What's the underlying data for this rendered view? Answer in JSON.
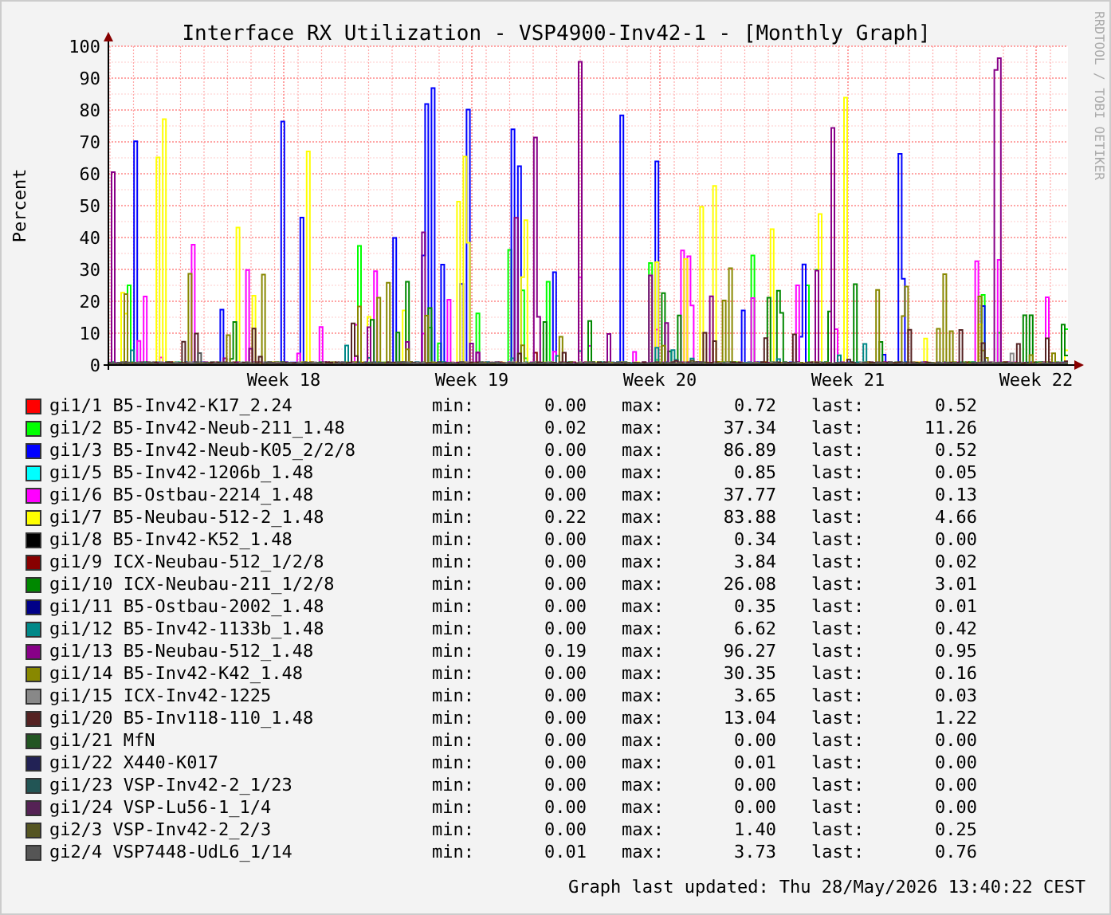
{
  "graph": {
    "title": "Interface RX Utilization - VSP4900-Inv42-1 - [Monthly Graph]",
    "ylabel": "Percent",
    "side_text": "RRDTOOL / TOBI OETIKER",
    "yticks": [
      "100",
      "90",
      "80",
      "70",
      "60",
      "50",
      "40",
      "30",
      "20",
      "10",
      "0"
    ],
    "xticks": [
      "Week 18",
      "Week 19",
      "Week 20",
      "Week 21",
      "Week 22"
    ]
  },
  "legend": [
    {
      "color": "#ff0000",
      "label": "gi1/1 B5-Inv42-K17_2.24",
      "min_label": "min:",
      "min": "0.00",
      "max_label": "max:",
      "max": "0.72",
      "last_label": "last:",
      "last": "0.52"
    },
    {
      "color": "#00ff00",
      "label": "gi1/2 B5-Inv42-Neub-211_1.48",
      "min_label": "min:",
      "min": "0.02",
      "max_label": "max:",
      "max": "37.34",
      "last_label": "last:",
      "last": "11.26"
    },
    {
      "color": "#0000ff",
      "label": "gi1/3 B5-Inv42-Neub-K05_2/2/8",
      "min_label": "min:",
      "min": "0.00",
      "max_label": "max:",
      "max": "86.89",
      "last_label": "last:",
      "last": "0.52"
    },
    {
      "color": "#00ffff",
      "label": "gi1/5 B5-Inv42-1206b_1.48",
      "min_label": "min:",
      "min": "0.00",
      "max_label": "max:",
      "max": "0.85",
      "last_label": "last:",
      "last": "0.05"
    },
    {
      "color": "#ff00ff",
      "label": "gi1/6 B5-Ostbau-2214_1.48",
      "min_label": "min:",
      "min": "0.00",
      "max_label": "max:",
      "max": "37.77",
      "last_label": "last:",
      "last": "0.13"
    },
    {
      "color": "#ffff00",
      "label": "gi1/7 B5-Neubau-512-2_1.48",
      "min_label": "min:",
      "min": "0.22",
      "max_label": "max:",
      "max": "83.88",
      "last_label": "last:",
      "last": "4.66"
    },
    {
      "color": "#000000",
      "label": "gi1/8 B5-Inv42-K52_1.48",
      "min_label": "min:",
      "min": "0.00",
      "max_label": "max:",
      "max": "0.34",
      "last_label": "last:",
      "last": "0.00"
    },
    {
      "color": "#880000",
      "label": "gi1/9 ICX-Neubau-512_1/2/8",
      "min_label": "min:",
      "min": "0.00",
      "max_label": "max:",
      "max": "3.84",
      "last_label": "last:",
      "last": "0.02"
    },
    {
      "color": "#008800",
      "label": "gi1/10 ICX-Neubau-211_1/2/8",
      "min_label": "min:",
      "min": "0.00",
      "max_label": "max:",
      "max": "26.08",
      "last_label": "last:",
      "last": "3.01"
    },
    {
      "color": "#000088",
      "label": "gi1/11 B5-Ostbau-2002_1.48",
      "min_label": "min:",
      "min": "0.00",
      "max_label": "max:",
      "max": "0.35",
      "last_label": "last:",
      "last": "0.01"
    },
    {
      "color": "#008888",
      "label": "gi1/12 B5-Inv42-1133b_1.48",
      "min_label": "min:",
      "min": "0.00",
      "max_label": "max:",
      "max": "6.62",
      "last_label": "last:",
      "last": "0.42"
    },
    {
      "color": "#880088",
      "label": "gi1/13 B5-Neubau-512_1.48",
      "min_label": "min:",
      "min": "0.19",
      "max_label": "max:",
      "max": "96.27",
      "last_label": "last:",
      "last": "0.95"
    },
    {
      "color": "#888800",
      "label": "gi1/14 B5-Inv42-K42_1.48",
      "min_label": "min:",
      "min": "0.00",
      "max_label": "max:",
      "max": "30.35",
      "last_label": "last:",
      "last": "0.16"
    },
    {
      "color": "#888888",
      "label": "gi1/15 ICX-Inv42-1225",
      "min_label": "min:",
      "min": "0.00",
      "max_label": "max:",
      "max": "3.65",
      "last_label": "last:",
      "last": "0.03"
    },
    {
      "color": "#552222",
      "label": "gi1/20 B5-Inv118-110_1.48",
      "min_label": "min:",
      "min": "0.00",
      "max_label": "max:",
      "max": "13.04",
      "last_label": "last:",
      "last": "1.22"
    },
    {
      "color": "#225522",
      "label": "gi1/21 MfN",
      "min_label": "min:",
      "min": "0.00",
      "max_label": "max:",
      "max": "0.00",
      "last_label": "last:",
      "last": "0.00"
    },
    {
      "color": "#222255",
      "label": "gi1/22 X440-K017",
      "min_label": "min:",
      "min": "0.00",
      "max_label": "max:",
      "max": "0.01",
      "last_label": "last:",
      "last": "0.00"
    },
    {
      "color": "#225555",
      "label": "gi1/23 VSP-Inv42-2_1/23",
      "min_label": "min:",
      "min": "0.00",
      "max_label": "max:",
      "max": "0.00",
      "last_label": "last:",
      "last": "0.00"
    },
    {
      "color": "#552255",
      "label": "gi1/24 VSP-Lu56-1_1/4",
      "min_label": "min:",
      "min": "0.00",
      "max_label": "max:",
      "max": "0.00",
      "last_label": "last:",
      "last": "0.00"
    },
    {
      "color": "#555522",
      "label": "gi2/3 VSP-Inv42-2_2/3",
      "min_label": "min:",
      "min": "0.00",
      "max_label": "max:",
      "max": "1.40",
      "last_label": "last:",
      "last": "0.25"
    },
    {
      "color": "#555555",
      "label": "gi2/4 VSP7448-UdL6_1/14",
      "min_label": "min:",
      "min": "0.01",
      "max_label": "max:",
      "max": "3.73",
      "last_label": "last:",
      "last": "0.76"
    }
  ],
  "footer": "Graph last updated: Thu 28/May/2026 13:40:22 CEST"
}
